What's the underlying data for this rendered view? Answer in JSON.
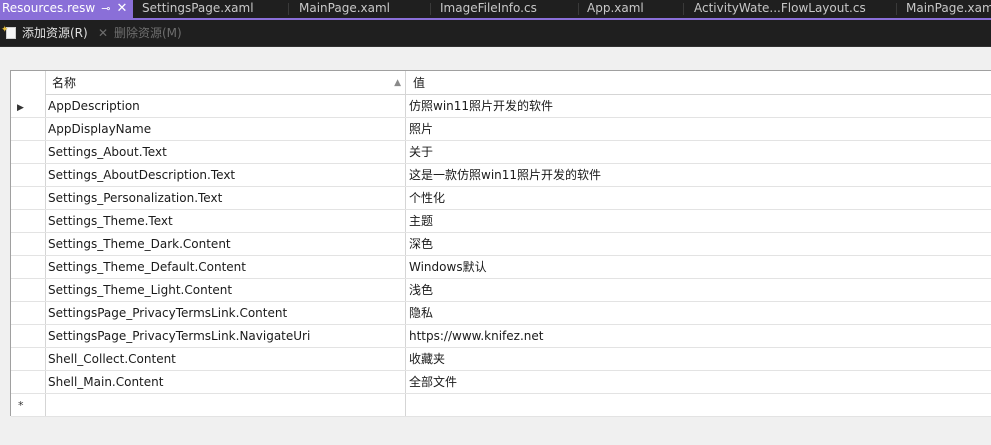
{
  "tabs": [
    {
      "label": "Resources.resw",
      "active": true
    },
    {
      "label": "SettingsPage.xaml"
    },
    {
      "label": "MainPage.xaml"
    },
    {
      "label": "ImageFileInfo.cs"
    },
    {
      "label": "App.xaml"
    },
    {
      "label": "ActivityWate...FlowLayout.cs"
    },
    {
      "label": "MainPage.xaml"
    }
  ],
  "tab_icons": {
    "pin": "pin-icon",
    "close": "close-icon"
  },
  "toolbar": {
    "add_label": "添加资源(R)",
    "remove_label": "删除资源(M)"
  },
  "grid": {
    "headers": {
      "name": "名称",
      "value": "值"
    },
    "rows": [
      {
        "name": "AppDescription",
        "value": "仿照win11照片开发的软件"
      },
      {
        "name": "AppDisplayName",
        "value": "照片"
      },
      {
        "name": "Settings_About.Text",
        "value": "关于"
      },
      {
        "name": "Settings_AboutDescription.Text",
        "value": "这是一款仿照win11照片开发的软件"
      },
      {
        "name": "Settings_Personalization.Text",
        "value": "个性化"
      },
      {
        "name": "Settings_Theme.Text",
        "value": "主题"
      },
      {
        "name": "Settings_Theme_Dark.Content",
        "value": "深色"
      },
      {
        "name": "Settings_Theme_Default.Content",
        "value": "Windows默认"
      },
      {
        "name": "Settings_Theme_Light.Content",
        "value": "浅色"
      },
      {
        "name": "SettingsPage_PrivacyTermsLink.Content",
        "value": "隐私"
      },
      {
        "name": "SettingsPage_PrivacyTermsLink.NavigateUri",
        "value": "https://www.knifez.net"
      },
      {
        "name": "Shell_Collect.Content",
        "value": "收藏夹"
      },
      {
        "name": "Shell_Main.Content",
        "value": "全部文件"
      }
    ],
    "new_row_marker": "*"
  },
  "colors": {
    "accent": "#8a6fd8",
    "chrome": "#1f1f1f",
    "background": "#f0f0f0"
  }
}
